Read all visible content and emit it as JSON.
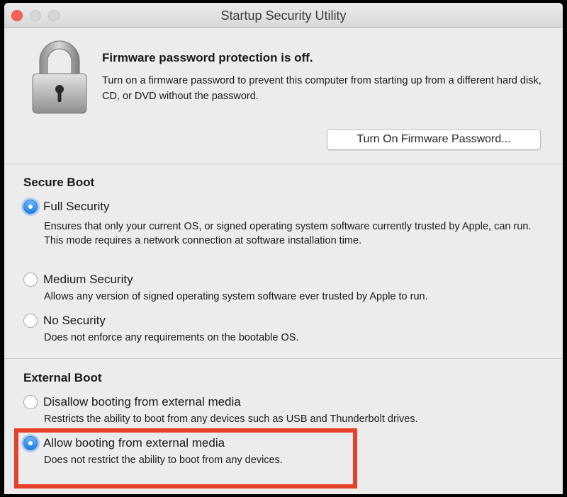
{
  "window": {
    "title": "Startup Security Utility"
  },
  "firmware": {
    "heading": "Firmware password protection is off.",
    "description": "Turn on a firmware password to prevent this computer from starting up from a different hard disk, CD, or DVD without the password.",
    "button_label": "Turn On Firmware Password..."
  },
  "secure_boot": {
    "title": "Secure Boot",
    "options": [
      {
        "label": "Full Security",
        "description": "Ensures that only your current OS, or signed operating system software currently trusted by Apple, can run. This mode requires a network connection at software installation time.",
        "checked": true
      },
      {
        "label": "Medium Security",
        "description": "Allows any version of signed operating system software ever trusted by Apple to run.",
        "checked": false
      },
      {
        "label": "No Security",
        "description": "Does not enforce any requirements on the bootable OS.",
        "checked": false
      }
    ]
  },
  "external_boot": {
    "title": "External Boot",
    "options": [
      {
        "label": "Disallow booting from external media",
        "description": "Restricts the ability to boot from any devices such as USB and Thunderbolt drives.",
        "checked": false
      },
      {
        "label": "Allow booting from external media",
        "description": "Does not restrict the ability to boot from any devices.",
        "checked": true
      }
    ]
  },
  "colors": {
    "accent_blue": "#1f7ee6",
    "highlight_red": "#e5402a",
    "window_bg": "#ececec"
  },
  "icons": {
    "lock": "padlock-icon"
  }
}
